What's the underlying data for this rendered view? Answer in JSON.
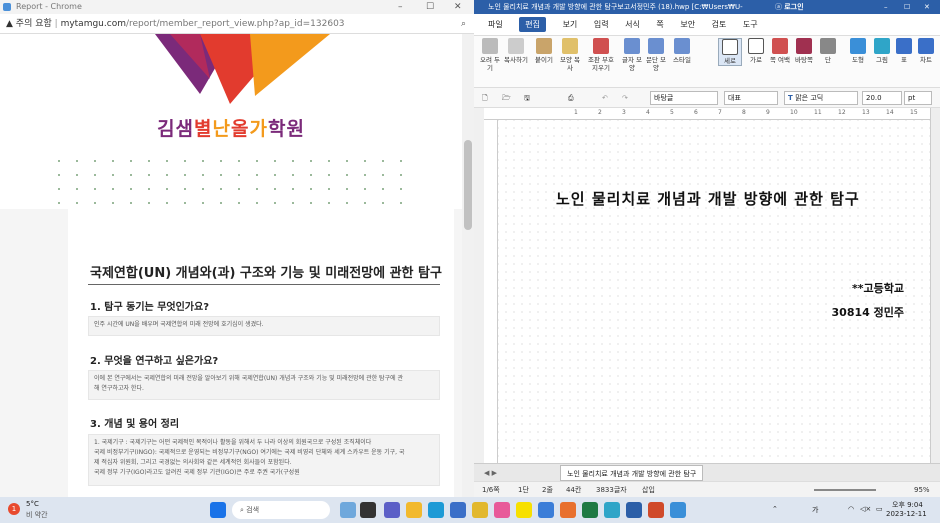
{
  "chrome": {
    "title": "Report - Chrome",
    "security_label": "주의 요함",
    "url_domain": "mytamgu.com",
    "url_path": "/report/member_report_view.php?ap_id=132603",
    "logo": [
      "김샘",
      "별",
      "난",
      "올",
      "가",
      "학원"
    ],
    "card": {
      "title": "국제연합(UN) 개념와(과) 구조와 기능 및 미래전망에 관한 탐구",
      "s1_heading": "1. 탐구 동기는 무엇인가요?",
      "s1_text": "인주 시간에 UN을 배우며 국제연합의 미래 전망에 호기심이 생겼다.",
      "s2_heading": "2. 무엇을 연구하고 싶은가요?",
      "s2_text1": "이에 본 연구에서는 국제연합의 미래 전망을 알아보기 위해 국제연합(UN) 개념과 구조와 기능 및 미래전망에 관한 탐구에 관",
      "s2_text2": "해 연구하고자 한다.",
      "s3_heading": "3. 개념 및 용어 정리",
      "s3_lines": [
        "1. 국제기구 : 국제기구는 어떤 국제적인 목적이나 활동을 위해서 두 나라 이상의 회원국으로 구성된 조직체이다",
        "국제 비정부기구(INGO): 국제적으로 운영되는 비정부기구(NGO) 여기에는 국제 비영리 단체와 세계 스카우트 운동 기구, 국",
        "제 적십자 위원회, 그리고 국경없는 의사회와 같은 세계적인 회사들이 포함된다.",
        "국제 정부 기구(IGO)라고도 알려진 국제 정부 기관(IGO)은 주로 주권 국가(구성원"
      ]
    }
  },
  "hwp": {
    "title": "노인 물리치료 개념과 개발 방향에 관한 탐구보고서정민주 (18).hwp [C:₩Users₩U-",
    "login": "로그인",
    "menu": [
      "파일",
      "편집",
      "보기",
      "입력",
      "서식",
      "쪽",
      "보안",
      "검토",
      "도구"
    ],
    "ribbon": [
      "오려 두기",
      "복사하기",
      "붙이기",
      "모양 복사",
      "조판 부호 지우기",
      "글자 모양",
      "문단 모양",
      "스타일",
      "세로",
      "가로",
      "쪽 여백",
      "바탕쪽",
      "단",
      "도형",
      "그림",
      "표",
      "차트"
    ],
    "style_box": "바탕글",
    "lang_box": "대표",
    "font_box": "맑은 고딕",
    "size_box": "20.0",
    "unit_box": "pt",
    "ruler_nums": [
      "1",
      "2",
      "3",
      "4",
      "5",
      "6",
      "7",
      "8",
      "9",
      "10",
      "11",
      "12",
      "13",
      "14",
      "15",
      "16"
    ],
    "doc_title": "노인 물리치료 개념과 개발 방향에 관한 탐구",
    "doc_school": "**고등학교",
    "doc_author": "30814 정민주",
    "tab_label": "노인 물리치료 개념과 개발 방향에 관한 탐구",
    "status": {
      "page": "1/6쪽",
      "section": "1단",
      "line": "2줄",
      "col": "44칸",
      "chars": "3833글자",
      "mode": "삽입",
      "zoom": "95%"
    }
  },
  "taskbar": {
    "weather_temp": "5°C",
    "weather_desc": "비 약간",
    "weather_badge": "1",
    "search": "검색",
    "time": "오후 9:04",
    "date": "2023-12-11",
    "ime": "가"
  },
  "colors": {
    "hwp_title": "#2c5fa8",
    "logo_red": "#e23b2e",
    "logo_orange": "#f39a1c",
    "logo_purple": "#7b2a7a"
  }
}
